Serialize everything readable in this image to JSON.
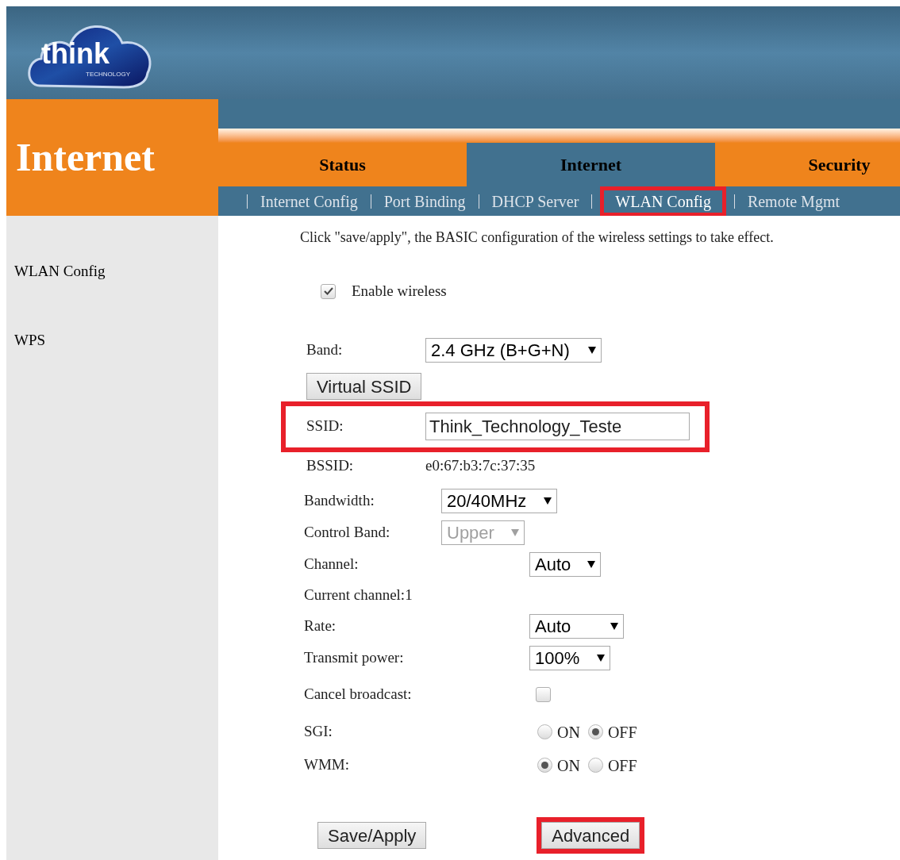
{
  "logo": {
    "name": "think",
    "tagline": "TECHNOLOGY"
  },
  "page_title": "Internet",
  "tabs": [
    {
      "label": "Status",
      "selected": false
    },
    {
      "label": "Internet",
      "selected": true
    },
    {
      "label": "Security",
      "selected": false
    }
  ],
  "subnav": [
    {
      "label": "Internet Config",
      "selected": false,
      "highlighted": false
    },
    {
      "label": "Port Binding",
      "selected": false,
      "highlighted": false
    },
    {
      "label": "DHCP Server",
      "selected": false,
      "highlighted": false
    },
    {
      "label": "WLAN Config",
      "selected": true,
      "highlighted": true
    },
    {
      "label": "Remote Mgmt",
      "selected": false,
      "highlighted": false
    }
  ],
  "sidebar": {
    "items": [
      {
        "label": "WLAN Config"
      },
      {
        "label": "WPS"
      }
    ]
  },
  "note": "Click \"save/apply\", the BASIC configuration of the wireless settings to take effect.",
  "enable_wireless": {
    "label": "Enable wireless",
    "checked": true
  },
  "sections": [
    {
      "rows": [
        {
          "kind": "select",
          "label": "Band:",
          "value": "2.4 GHz (B+G+N)",
          "disabled": false,
          "highlighted": false
        },
        {
          "kind": "button",
          "label": "Virtual SSID",
          "highlighted": false
        },
        {
          "kind": "text",
          "label": "SSID:",
          "value": "Think_Technology_Teste",
          "highlighted": true
        },
        {
          "kind": "info",
          "label": "BSSID:",
          "value": "e0:67:b3:7c:37:35",
          "highlighted": false
        }
      ]
    },
    {
      "rows": [
        {
          "kind": "select",
          "label": "Bandwidth:",
          "value": "20/40MHz",
          "disabled": false,
          "highlighted": false
        },
        {
          "kind": "select",
          "label": "Control Band:",
          "value": "Upper",
          "disabled": true,
          "highlighted": false
        }
      ]
    },
    {
      "rows": [
        {
          "kind": "select",
          "label": "Channel:",
          "value": "Auto",
          "disabled": false,
          "highlighted": false
        },
        {
          "kind": "label",
          "label": "Current channel:1",
          "highlighted": false
        },
        {
          "kind": "select",
          "label": "Rate:",
          "value": "Auto",
          "disabled": false,
          "highlighted": false
        },
        {
          "kind": "select",
          "label": "Transmit power:",
          "value": "100%",
          "disabled": false,
          "highlighted": false
        },
        {
          "kind": "checkbox",
          "label": "Cancel broadcast:",
          "checked": false,
          "highlighted": false
        },
        {
          "kind": "radio",
          "label": "SGI:",
          "options": [
            {
              "label": "ON",
              "selected": false
            },
            {
              "label": "OFF",
              "selected": true
            }
          ],
          "highlighted": false
        },
        {
          "kind": "radio",
          "label": "WMM:",
          "options": [
            {
              "label": "ON",
              "selected": true
            },
            {
              "label": "OFF",
              "selected": false
            }
          ],
          "highlighted": false
        }
      ]
    }
  ],
  "actions": [
    {
      "label": "Save/Apply",
      "highlighted": false
    },
    {
      "label": "Advanced",
      "highlighted": true
    }
  ]
}
